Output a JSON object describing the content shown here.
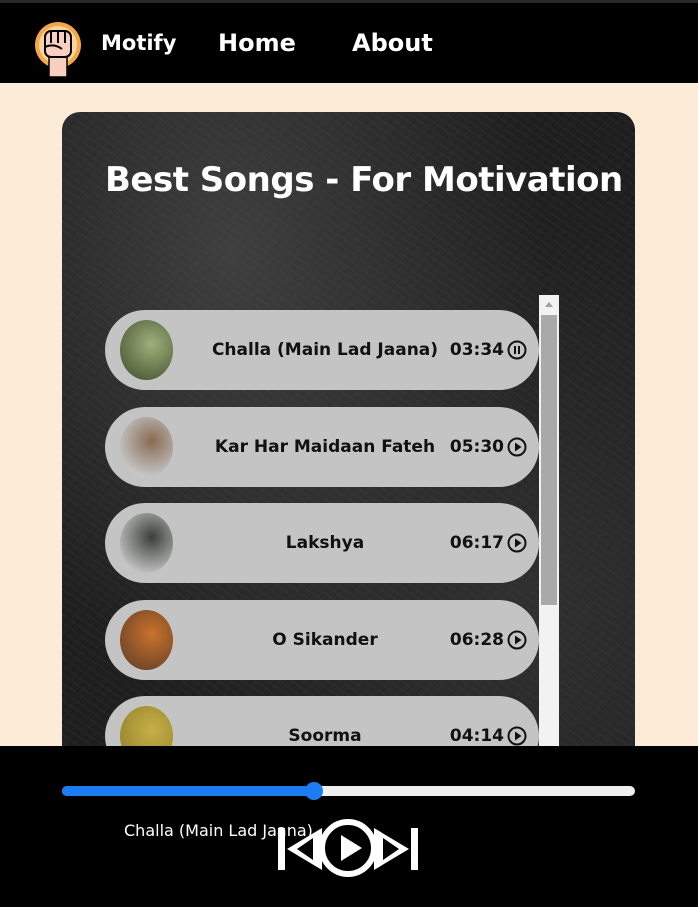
{
  "navbar": {
    "brand": "Motify",
    "links": [
      {
        "label": "Home"
      },
      {
        "label": "About"
      }
    ]
  },
  "main": {
    "title": "Best Songs - For Motivation",
    "songs": [
      {
        "name": "Challa (Main Lad Jaana)",
        "duration": "03:34",
        "state": "pause-icon",
        "cover_colors": [
          "#3b4a2a",
          "#9fb07a"
        ]
      },
      {
        "name": "Kar Har Maidaan Fateh",
        "duration": "05:30",
        "state": "play-icon",
        "cover_colors": [
          "#d9e6ef",
          "#8a6a52"
        ]
      },
      {
        "name": "Lakshya",
        "duration": "06:17",
        "state": "play-icon",
        "cover_colors": [
          "#e9e9e9",
          "#3a3f3a"
        ]
      },
      {
        "name": "O Sikander",
        "duration": "06:28",
        "state": "play-icon",
        "cover_colors": [
          "#5a3a2a",
          "#c9722a"
        ]
      },
      {
        "name": "Soorma",
        "duration": "04:14",
        "state": "play-icon",
        "cover_colors": [
          "#8a7a22",
          "#c8b04a"
        ]
      }
    ]
  },
  "player": {
    "now_playing": "Challa (Main Lad Jaana)",
    "progress": 0.44,
    "accent": "#1d7cf2"
  }
}
